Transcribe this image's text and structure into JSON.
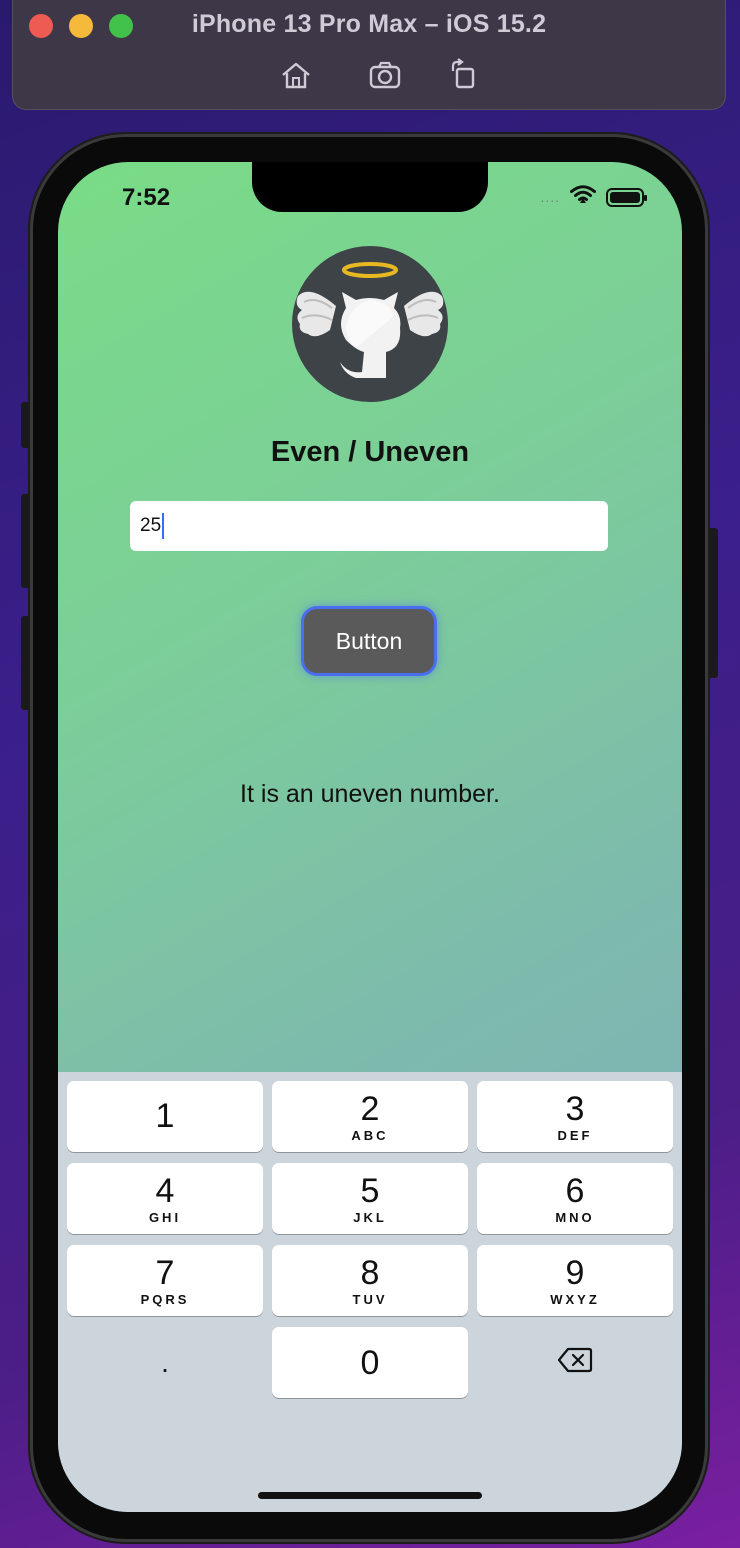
{
  "simulator": {
    "title": "iPhone 13 Pro Max – iOS 15.2",
    "tools": [
      "home-icon",
      "screenshot-icon",
      "rotate-icon"
    ]
  },
  "status_bar": {
    "time": "7:52",
    "signal": "....",
    "icons": [
      "wifi-icon",
      "battery-icon"
    ]
  },
  "app": {
    "logo": "octocat-angel-logo",
    "title": "Even / Uneven",
    "input_value": "25",
    "button_label": "Button",
    "result_text": "It is an uneven number."
  },
  "keyboard": {
    "keys": [
      {
        "digit": "1",
        "letters": ""
      },
      {
        "digit": "2",
        "letters": "ABC"
      },
      {
        "digit": "3",
        "letters": "DEF"
      },
      {
        "digit": "4",
        "letters": "GHI"
      },
      {
        "digit": "5",
        "letters": "JKL"
      },
      {
        "digit": "6",
        "letters": "MNO"
      },
      {
        "digit": "7",
        "letters": "PQRS"
      },
      {
        "digit": "8",
        "letters": "TUV"
      },
      {
        "digit": "9",
        "letters": "WXYZ"
      },
      {
        "digit": ".",
        "letters": ""
      },
      {
        "digit": "0",
        "letters": ""
      }
    ],
    "delete_icon": "delete-backspace-icon"
  },
  "colors": {
    "button_bg": "#5a5a5a",
    "button_focus": "#4a6ef0",
    "gradient_start": "#79dc86",
    "gradient_end": "#80a9c0",
    "caret": "#3b6cf5"
  }
}
